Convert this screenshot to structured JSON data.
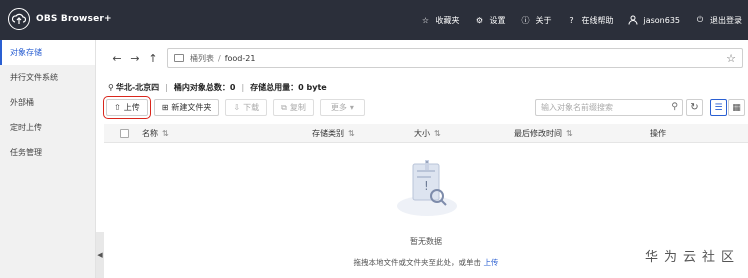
{
  "app": {
    "title": "OBS Browser+"
  },
  "topbar": {
    "items": [
      {
        "label": "收藏夹",
        "icon": "star-icon"
      },
      {
        "label": "设置",
        "icon": "gear-icon"
      },
      {
        "label": "关于",
        "icon": "info-icon"
      },
      {
        "label": "在线帮助",
        "icon": "help-icon"
      },
      {
        "label": "jason635",
        "icon": "user-icon"
      },
      {
        "label": "退出登录",
        "icon": "power-icon"
      }
    ]
  },
  "sidebar": {
    "items": [
      {
        "label": "对象存储",
        "active": true
      },
      {
        "label": "并行文件系统",
        "active": false
      },
      {
        "label": "外部桶",
        "active": false
      },
      {
        "label": "定时上传",
        "active": false
      },
      {
        "label": "任务管理",
        "active": false
      }
    ]
  },
  "nav": {
    "breadcrumb_root": "桶列表",
    "breadcrumb_sep": "/",
    "breadcrumb_current": "food-21"
  },
  "info": {
    "region": "华北-北京四",
    "object_count_label": "桶内对象总数：0",
    "storage_label": "存储总用量：0 byte"
  },
  "toolbar": {
    "upload": "上传",
    "new_folder": "新建文件夹",
    "download": "下载",
    "copy": "复制",
    "more": "更多"
  },
  "search": {
    "placeholder": "输入对象名前缀搜索"
  },
  "table": {
    "columns": [
      "名称",
      "存储类别",
      "大小",
      "最后修改时间",
      "操作"
    ]
  },
  "empty": {
    "title": "暂无数据",
    "hint": "拖拽本地文件或文件夹至此处，或单击",
    "hint_link": "上传"
  },
  "watermark": "华为云社区",
  "colors": {
    "topbar": "#2b2f3a",
    "accent": "#2a5fd2",
    "highlight": "#d9261c"
  }
}
